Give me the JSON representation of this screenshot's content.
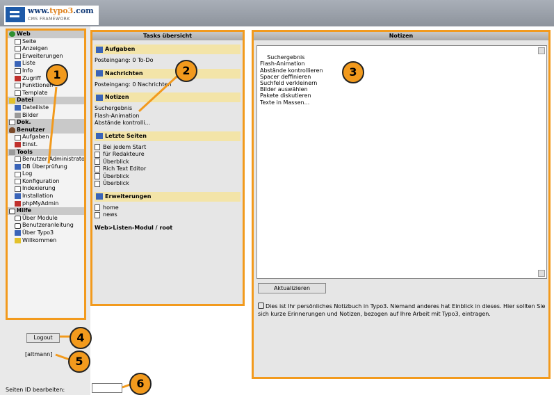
{
  "logo": {
    "url_pre": "www.",
    "url_accent": "typo3",
    "url_post": ".com",
    "tagline": "CMS FRAMEWORK"
  },
  "menu": [
    {
      "label": "Web",
      "type": "group",
      "icon": "globe-icon"
    },
    {
      "label": "Seite",
      "type": "sub",
      "icon": "page-icon"
    },
    {
      "label": "Anzeigen",
      "type": "sub",
      "icon": "view-icon"
    },
    {
      "label": "Erweiterungen",
      "type": "sub",
      "icon": "extension-icon"
    },
    {
      "label": "Liste",
      "type": "sub",
      "icon": "list-icon"
    },
    {
      "label": "Info",
      "type": "sub",
      "icon": "info-icon"
    },
    {
      "label": "Zugriff",
      "type": "sub",
      "icon": "access-icon"
    },
    {
      "label": "Funktionen",
      "type": "sub",
      "icon": "functions-icon"
    },
    {
      "label": "Template",
      "type": "sub",
      "icon": "template-icon"
    },
    {
      "label": "Datei",
      "type": "group",
      "icon": "folder-icon"
    },
    {
      "label": "Dateiliste",
      "type": "sub",
      "icon": "filelist-icon"
    },
    {
      "label": "Bilder",
      "type": "sub",
      "icon": "images-icon"
    },
    {
      "label": "Dok.",
      "type": "group",
      "icon": "doc-icon"
    },
    {
      "label": "Benutzer",
      "type": "group",
      "icon": "user-icon"
    },
    {
      "label": "Aufgaben",
      "type": "sub",
      "icon": "tasks-icon"
    },
    {
      "label": "Einst.",
      "type": "sub",
      "icon": "settings-icon"
    },
    {
      "label": "Tools",
      "type": "group",
      "icon": "tools-icon"
    },
    {
      "label": "Benutzer Administrator",
      "type": "sub",
      "icon": "user-admin-icon"
    },
    {
      "label": "DB Überprüfung",
      "type": "sub",
      "icon": "database-icon"
    },
    {
      "label": "Log",
      "type": "sub",
      "icon": "log-icon"
    },
    {
      "label": "Konfiguration",
      "type": "sub",
      "icon": "config-icon"
    },
    {
      "label": "Indexierung",
      "type": "sub",
      "icon": "index-icon"
    },
    {
      "label": "Installation",
      "type": "sub",
      "icon": "install-icon"
    },
    {
      "label": "phpMyAdmin",
      "type": "sub",
      "icon": "phpmyadmin-icon"
    },
    {
      "label": "Hilfe",
      "type": "group",
      "icon": "help-icon"
    },
    {
      "label": "Über Module",
      "type": "sub",
      "icon": "help-icon"
    },
    {
      "label": "Benutzeranleitung",
      "type": "sub",
      "icon": "help-icon"
    },
    {
      "label": "Über Typo3",
      "type": "sub",
      "icon": "typo3-icon"
    },
    {
      "label": "Willkommen",
      "type": "sub",
      "icon": "welcome-icon"
    }
  ],
  "tasks": {
    "title": "Tasks übersicht",
    "aufgaben": {
      "heading": "Aufgaben",
      "text": "Posteingang: 0 To-Do"
    },
    "nachrichten": {
      "heading": "Nachrichten",
      "text": "Posteingang: 0 Nachrichten"
    },
    "notizen": {
      "heading": "Notizen",
      "items": [
        "Suchergebnis",
        "Flash-Animation",
        "Abstände kontrolli..."
      ]
    },
    "letzte": {
      "heading": "Letzte Seiten",
      "items": [
        "Bei jedem Start",
        "für Redakteure",
        "Überblick",
        "Rich Text Editor",
        "Überblick",
        "Überblick"
      ]
    },
    "erweiterungen": {
      "heading": "Erweiterungen",
      "items": [
        "home",
        "news"
      ]
    },
    "path": "Web>Listen-Modul / root"
  },
  "notes": {
    "title": "Notizen",
    "content": "Suchergebnis\nFlash-Animation\nAbstände kontrollieren\nSpacer deffinieren\nSuchfeld verkleinern\nBilder auswählen\nPakete diskutieren\nTexte in Massen...",
    "button": "Aktualizieren",
    "info": "Dies ist Ihr persönliches Notizbuch in Typo3. Niemand anderes hat Einblick in dieses. Hier sollten Sie sich kurze Erinnerungen und Notizen, bezogen auf Ihre Arbeit mit Typo3, eintragen."
  },
  "footer": {
    "logout": "Logout",
    "user": "[altmann]",
    "pageid_label": "Seiten ID bearbeiten:",
    "pageid_value": ""
  },
  "callouts": [
    "1",
    "2",
    "3",
    "4",
    "5",
    "6"
  ],
  "colors": {
    "accent": "#f29a1d",
    "topbar": "#9ca2ab",
    "section": "#f3e4a8"
  }
}
